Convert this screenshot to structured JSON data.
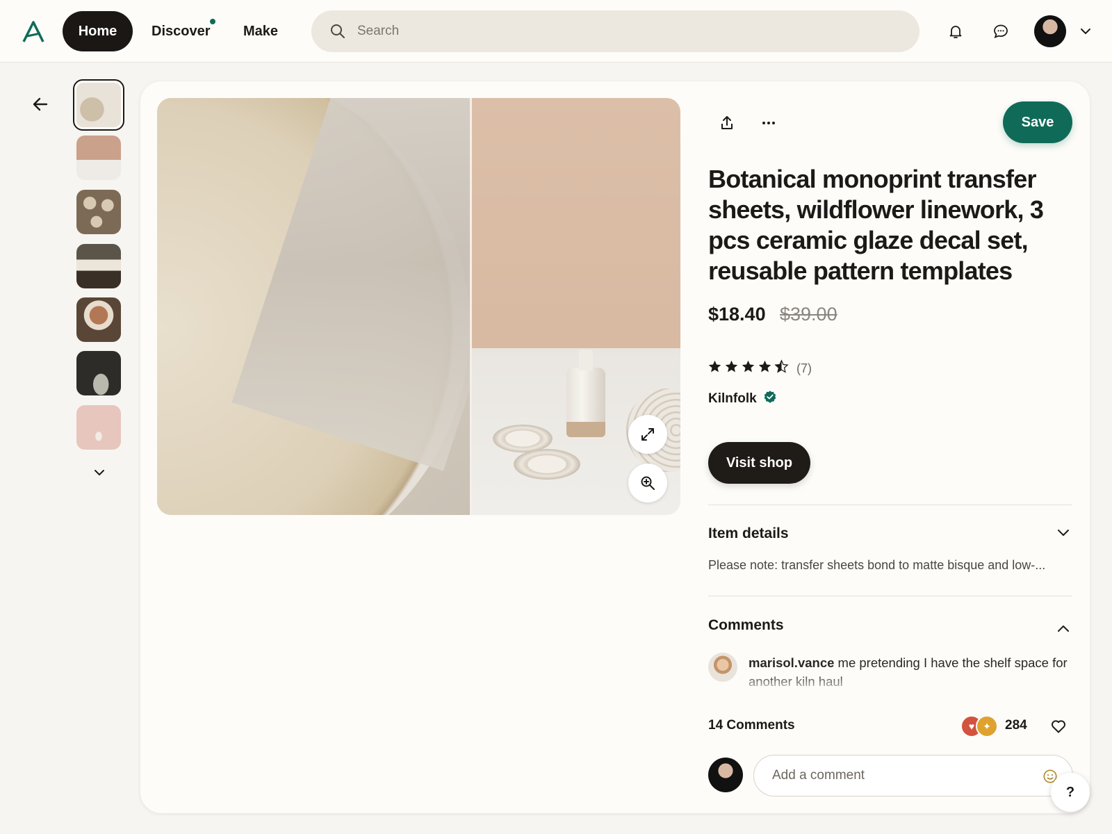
{
  "nav": {
    "logo_icon": "brand-a-logo",
    "home_label": "Home",
    "discover_label": "Discover",
    "make_label": "Make",
    "search_placeholder": "Search",
    "accent_color": "#0f6b58"
  },
  "thumbnails": [
    {
      "alt": "plates and linen",
      "active": true
    },
    {
      "alt": "bottle and dishes",
      "active": false
    },
    {
      "alt": "stacked bowls",
      "active": false
    },
    {
      "alt": "table setting",
      "active": false
    },
    {
      "alt": "bowl on plates",
      "active": false
    },
    {
      "alt": "dark vases",
      "active": false
    },
    {
      "alt": "pink vase",
      "active": false
    }
  ],
  "product": {
    "title": "Botanical monoprint transfer sheets, wildflower linework, 3 pcs ceramic glaze decal set, reusable pattern templates",
    "price": "$18.40",
    "original_price": "$39.00",
    "rating": 4.5,
    "rating_count": "(7)",
    "seller": "Kilnfolk",
    "seller_verified": true,
    "save_label": "Save",
    "visit_shop_label": "Visit shop"
  },
  "item_details": {
    "title": "Item details",
    "text": "Please note: transfer sheets bond to matte bisque and low-..."
  },
  "comments": {
    "title": "Comments",
    "items": [
      {
        "user": "marisol.vance",
        "text": "me pretending I have the shelf space for another kiln haul"
      }
    ],
    "count_label": "14 Comments",
    "reactions_count": "284",
    "input_placeholder": "Add a comment"
  },
  "help_label": "?"
}
